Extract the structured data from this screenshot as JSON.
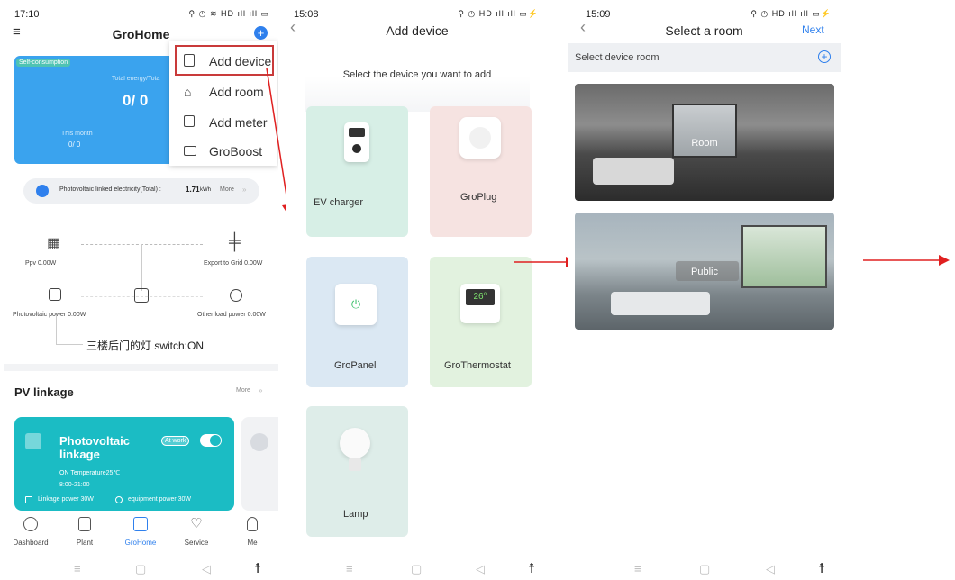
{
  "screen1": {
    "status_time": "17:10",
    "status_icons": "⚲ ◷ ≋ HD ıll ıll ▭",
    "menu_icon": "≡",
    "title": "GroHome",
    "add_icon": "+",
    "card": {
      "badge": "Self-consumption",
      "total_label": "Total energy/Tota",
      "total_value": "0/ 0",
      "month_label": "This month",
      "month_value": "0/ 0"
    },
    "dropdown": {
      "items": [
        {
          "label": "Add device",
          "icon": "device-icon"
        },
        {
          "label": "Add room",
          "icon": "home-icon"
        },
        {
          "label": "Add meter",
          "icon": "meter-icon"
        },
        {
          "label": "GroBoost",
          "icon": "boost-icon"
        }
      ]
    },
    "info_bar": {
      "text": "Photovoltaic linked electricity(Total) :",
      "value": "1.71",
      "unit": "kWh",
      "more": "More",
      "more_arrow": "»"
    },
    "flow": {
      "ppv": "Ppv 0.00W",
      "export": "Export to Grid 0.00W",
      "pv_power": "Photovoltaic power 0.00W",
      "other_load": "Other load power 0.00W",
      "switch_text": "三楼后门的灯  switch:ON"
    },
    "pv_linkage": {
      "title": "PV linkage",
      "more": "More",
      "more_arrow": "»",
      "card_title": "Photovoltaic linkage",
      "badge": "At work",
      "condition": "ON Temperature25℃",
      "time": "8:00-21:00",
      "linkage_power": "Linkage power 30W",
      "equipment_power": "equipment power 30W"
    },
    "tabs": [
      {
        "label": "Dashboard",
        "icon": "dashboard-icon"
      },
      {
        "label": "Plant",
        "icon": "plant-icon"
      },
      {
        "label": "GroHome",
        "icon": "grohome-icon"
      },
      {
        "label": "Service",
        "icon": "service-icon"
      },
      {
        "label": "Me",
        "icon": "me-icon"
      }
    ]
  },
  "screen2": {
    "status_time": "15:08",
    "status_icons": "⚲ ◷ HD ıll ıll ▭⚡",
    "back": "‹",
    "title": "Add device",
    "subtitle": "Select the device you want to add",
    "devices": [
      {
        "label": "EV charger",
        "color": "#d7efe6"
      },
      {
        "label": "GroPlug",
        "color": "#f6e3e1"
      },
      {
        "label": "GroPanel",
        "color": "#dbe8f3"
      },
      {
        "label": "GroThermostat",
        "color": "#e2f2df"
      },
      {
        "label": "Lamp",
        "color": "#deede9"
      }
    ],
    "thermo_display": "26°"
  },
  "screen3": {
    "status_time": "15:09",
    "status_icons": "⚲ ◷ HD ıll ıll ▭⚡",
    "back": "‹",
    "title": "Select a room",
    "next": "Next",
    "section_label": "Select device room",
    "add_icon": "+",
    "rooms": [
      "Room",
      "Public"
    ]
  },
  "system_nav": {
    "menu": "≡",
    "home": "▢",
    "back": "◁",
    "access": "☨"
  },
  "colors": {
    "accent": "#2f80ed",
    "teal": "#1bbcc4",
    "card_blue": "#3aa3ee",
    "arrow": "#e02020"
  }
}
